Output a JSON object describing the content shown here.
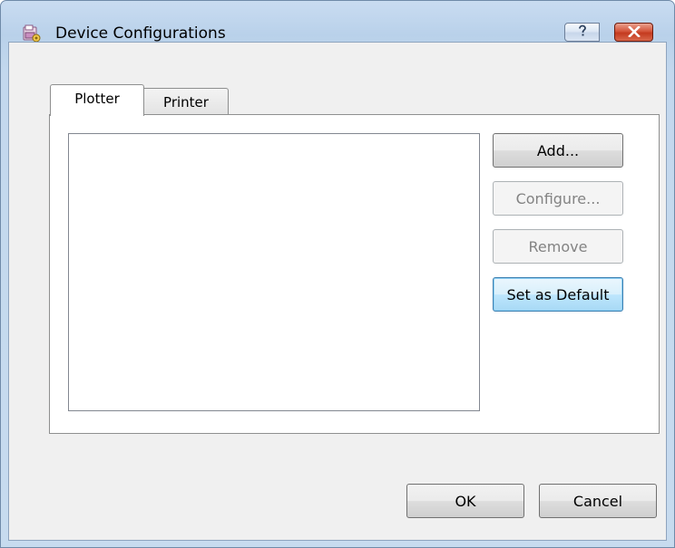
{
  "window": {
    "title": "Device Configurations",
    "icon": "device-config-app-icon",
    "controls": {
      "help_icon": "question-mark-icon",
      "close_icon": "close-x-icon"
    }
  },
  "tabs": [
    {
      "label": "Plotter",
      "selected": true
    },
    {
      "label": "Printer",
      "selected": false
    }
  ],
  "device_list": {
    "items": []
  },
  "actions": {
    "add_label": "Add...",
    "configure_label": "Configure...",
    "remove_label": "Remove",
    "set_default_label": "Set as Default"
  },
  "footer": {
    "ok_label": "OK",
    "cancel_label": "Cancel"
  },
  "colors": {
    "close_button": "#c43a1f",
    "focus_blue": "#3c7fb1",
    "disabled_text": "#838383"
  }
}
